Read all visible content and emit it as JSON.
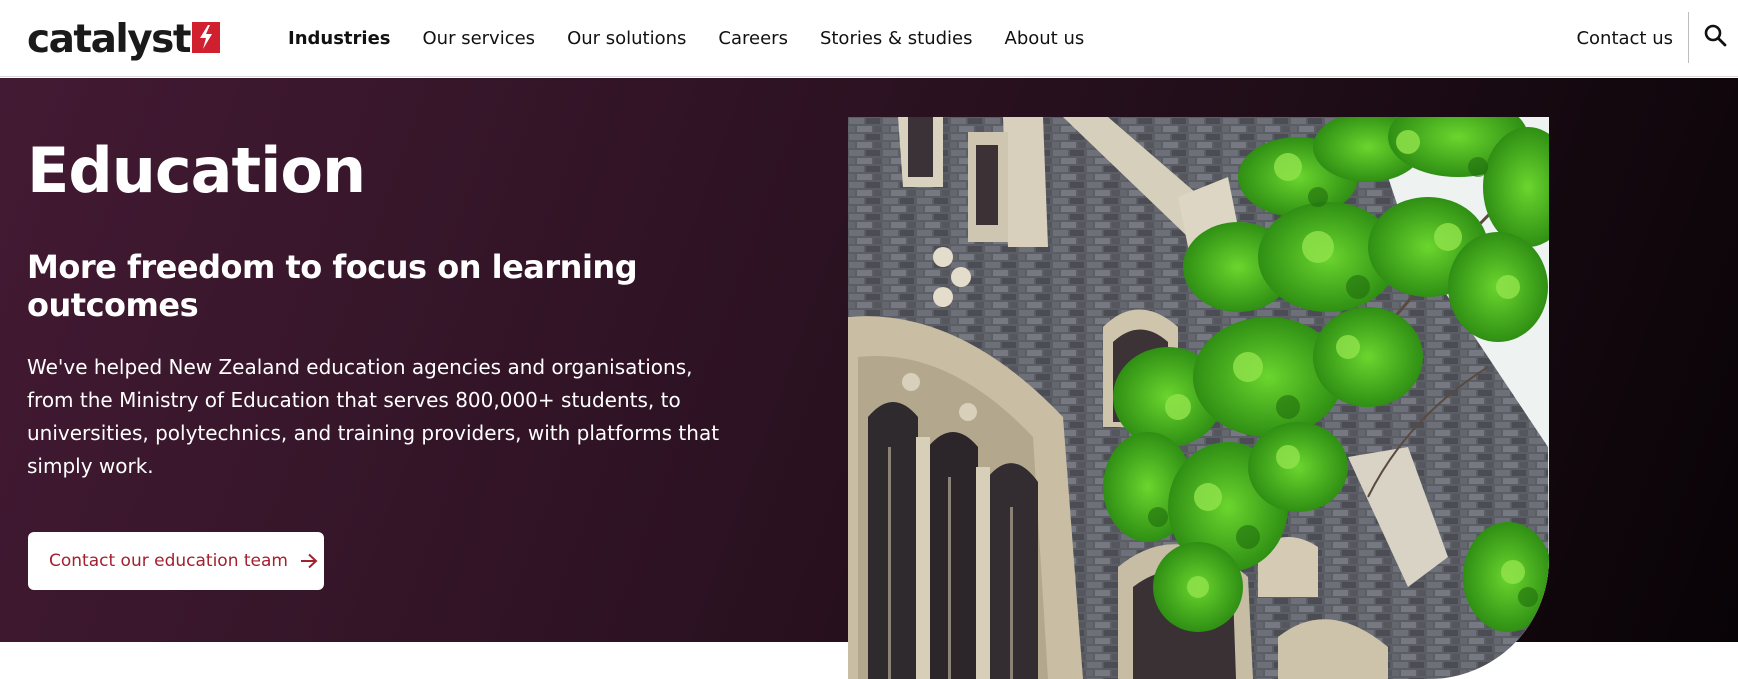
{
  "brand": {
    "name": "catalyst",
    "accent": "#d0202f"
  },
  "nav": {
    "items": [
      {
        "label": "Industries",
        "active": true
      },
      {
        "label": "Our services",
        "active": false
      },
      {
        "label": "Our solutions",
        "active": false
      },
      {
        "label": "Careers",
        "active": false
      },
      {
        "label": "Stories & studies",
        "active": false
      },
      {
        "label": "About us",
        "active": false
      }
    ],
    "contact_label": "Contact us",
    "search_icon": "search-icon"
  },
  "hero": {
    "title": "Education",
    "subtitle": "More freedom to focus on learning outcomes",
    "body": "We've helped New Zealand education agencies and organisations, from the Ministry of Education that serves 800,000+ students, to universities, polytechnics, and training providers, with platforms that simply work.",
    "cta_label": "Contact our education team",
    "cta_icon": "arrow-right-icon",
    "background": "#2c1222",
    "cta_color": "#a3202f"
  }
}
